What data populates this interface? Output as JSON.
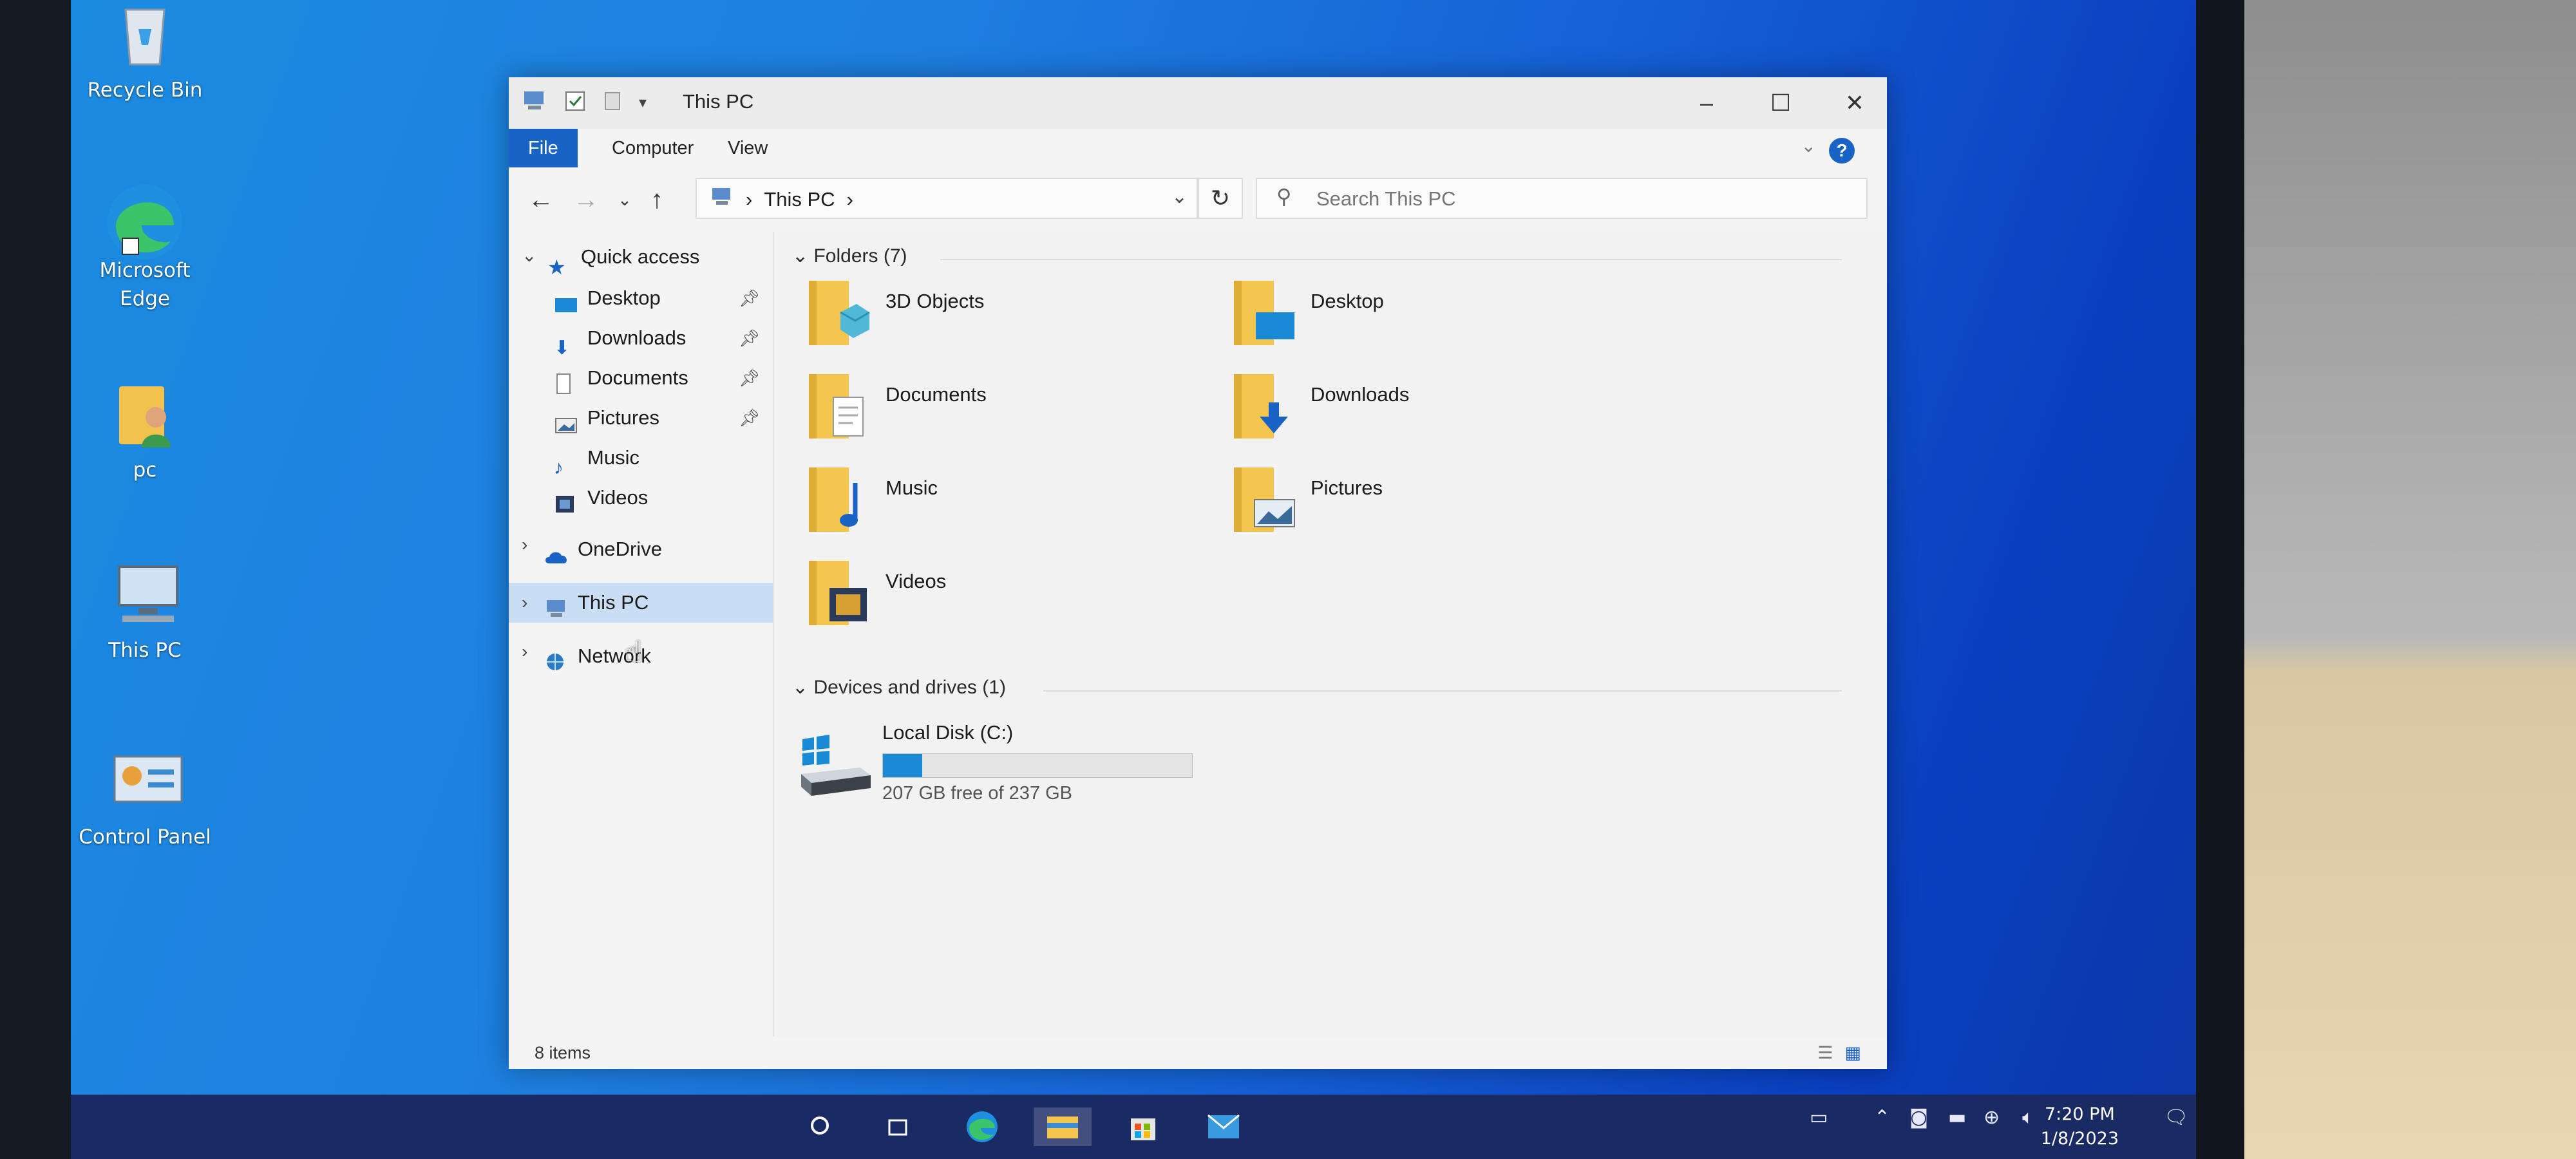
{
  "desktop": {
    "icons": [
      {
        "label": "Recycle Bin"
      },
      {
        "label": "Microsoft Edge"
      },
      {
        "label": "pc"
      },
      {
        "label": "This PC"
      },
      {
        "label": "Control Panel"
      }
    ]
  },
  "window": {
    "title": "This PC",
    "ribbon": {
      "file": "File",
      "computer": "Computer",
      "view": "View",
      "help": "?"
    },
    "address": {
      "location": "This PC"
    },
    "search": {
      "placeholder": "Search This PC"
    },
    "nav": {
      "quick_access": "Quick access",
      "quick_items": [
        {
          "label": "Desktop",
          "pinned": true
        },
        {
          "label": "Downloads",
          "pinned": true
        },
        {
          "label": "Documents",
          "pinned": true
        },
        {
          "label": "Pictures",
          "pinned": true
        },
        {
          "label": "Music",
          "pinned": false
        },
        {
          "label": "Videos",
          "pinned": false
        }
      ],
      "onedrive": "OneDrive",
      "this_pc": "This PC",
      "network": "Network"
    },
    "folders_header": "Folders (7)",
    "folders": [
      {
        "name": "3D Objects"
      },
      {
        "name": "Desktop"
      },
      {
        "name": "Documents"
      },
      {
        "name": "Downloads"
      },
      {
        "name": "Music"
      },
      {
        "name": "Pictures"
      },
      {
        "name": "Videos"
      }
    ],
    "drives_header": "Devices and drives (1)",
    "drive": {
      "name": "Local Disk (C:)",
      "free_text": "207 GB free of 237 GB",
      "used_fraction": 0.127
    },
    "status": {
      "items": "8 items"
    }
  },
  "taskbar": {
    "time": "7:20 PM",
    "date": "1/8/2023"
  },
  "colors": {
    "accent": "#1a63c6",
    "desktop": "#1e7ee0",
    "selection": "#c9def5"
  }
}
